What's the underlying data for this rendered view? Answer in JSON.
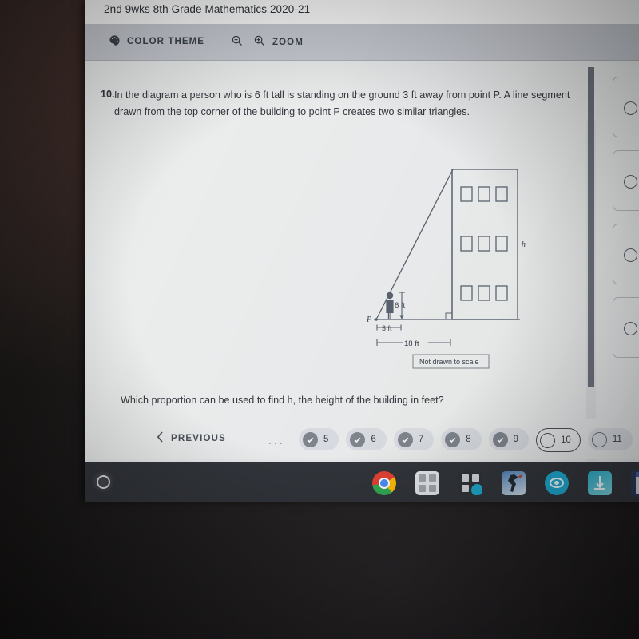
{
  "window": {
    "title": "2nd 9wks 8th Grade Mathematics 2020-21"
  },
  "toolbar": {
    "color_theme_label": "COLOR THEME",
    "color_theme_icon": "palette-icon",
    "zoom_label": "ZOOM",
    "zoom_out_icon": "magnifier-minus-icon",
    "zoom_in_icon": "magnifier-plus-icon"
  },
  "question": {
    "number": "10.",
    "body": "In the diagram a person who is 6 ft tall is standing on the ground 3 ft away from point P. A line segment drawn from the top corner of the building to point P creates two similar triangles.",
    "prompt": "Which proportion can be used to find h, the height of the building in feet?"
  },
  "diagram": {
    "point_label": "P",
    "person_height_label": "6 ft",
    "person_distance_label": "3 ft",
    "total_distance_label": "18 ft",
    "building_height_label": "h",
    "disclaimer": "Not drawn to scale",
    "building_window_rows": 3,
    "building_window_cols": 3,
    "stroke_color": "#5a6470"
  },
  "nav": {
    "previous_label": "PREVIOUS",
    "previous_icon": "chevron-left-icon",
    "ellipsis": "...",
    "pills": [
      {
        "number": "5",
        "state": "answered"
      },
      {
        "number": "6",
        "state": "answered"
      },
      {
        "number": "7",
        "state": "answered"
      },
      {
        "number": "8",
        "state": "answered"
      },
      {
        "number": "9",
        "state": "answered"
      },
      {
        "number": "10",
        "state": "current"
      },
      {
        "number": "11",
        "state": "unanswered"
      }
    ]
  },
  "answer_options": {
    "count": 4,
    "note": "option cards clipped at right edge of screen"
  },
  "taskbar": {
    "launcher_icon": "circle-launcher-icon",
    "items": [
      {
        "name": "chrome-icon"
      },
      {
        "name": "app-grid-icon"
      },
      {
        "name": "calculator-icon"
      },
      {
        "name": "photo-figure-icon"
      },
      {
        "name": "eye-icon"
      },
      {
        "name": "teal-app-icon"
      },
      {
        "name": "window-preview-icon"
      }
    ]
  },
  "colors": {
    "screen_bg": "#e9eaeb",
    "toolbar_bg": "#c9ccd3",
    "text": "#33383e",
    "pill_bg": "#dbdee3",
    "taskbar_bg": "#31343a"
  }
}
